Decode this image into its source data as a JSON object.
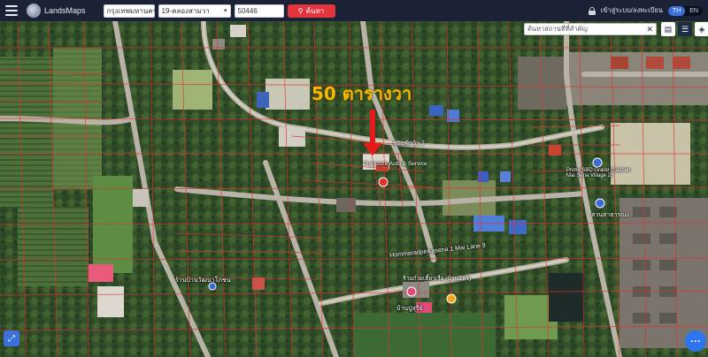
{
  "header": {
    "brand": "LandsMaps",
    "province_select": "กรุงเทพมหานคร",
    "district_select": "19-คลองสามวา",
    "parcel_input": "50446",
    "search_button": "ค้นหา",
    "login_text": "เข้าสู่ระบบ/ลงทะเบียน",
    "lang_th": "TH",
    "lang_en": "EN"
  },
  "map": {
    "search_placeholder": "ค้นหาสถานที่ที่สำคัญ",
    "annotation": "50 ตารางวา",
    "pois": [
      "ซอยฟักวิว 2",
      "Pranstore Auto & Service",
      "Prime SBD Grand (Saphan Mai Sena Village 2)",
      "สวนสาธารณะ",
      "Hommaradpinkasena 1 Mai Lane 9",
      "ร้านบ้านวัฒนาโภชน",
      "ร้านก๋วยเตี๋ยวเรือ (บ้านฉัตร)",
      "บ้านปู่สุรีย์"
    ]
  },
  "colors": {
    "navbar": "#1b2236",
    "search_button": "#e4353f",
    "annotation": "#f6b800",
    "parcel_lines": "#e0332e",
    "arrow": "#e51a1a"
  },
  "icons": [
    "hamburger-icon",
    "brand-logo-icon",
    "search-icon",
    "lock-icon",
    "close-icon",
    "printer-icon",
    "list-icon",
    "layers-icon",
    "locate-icon",
    "chat-icon"
  ]
}
